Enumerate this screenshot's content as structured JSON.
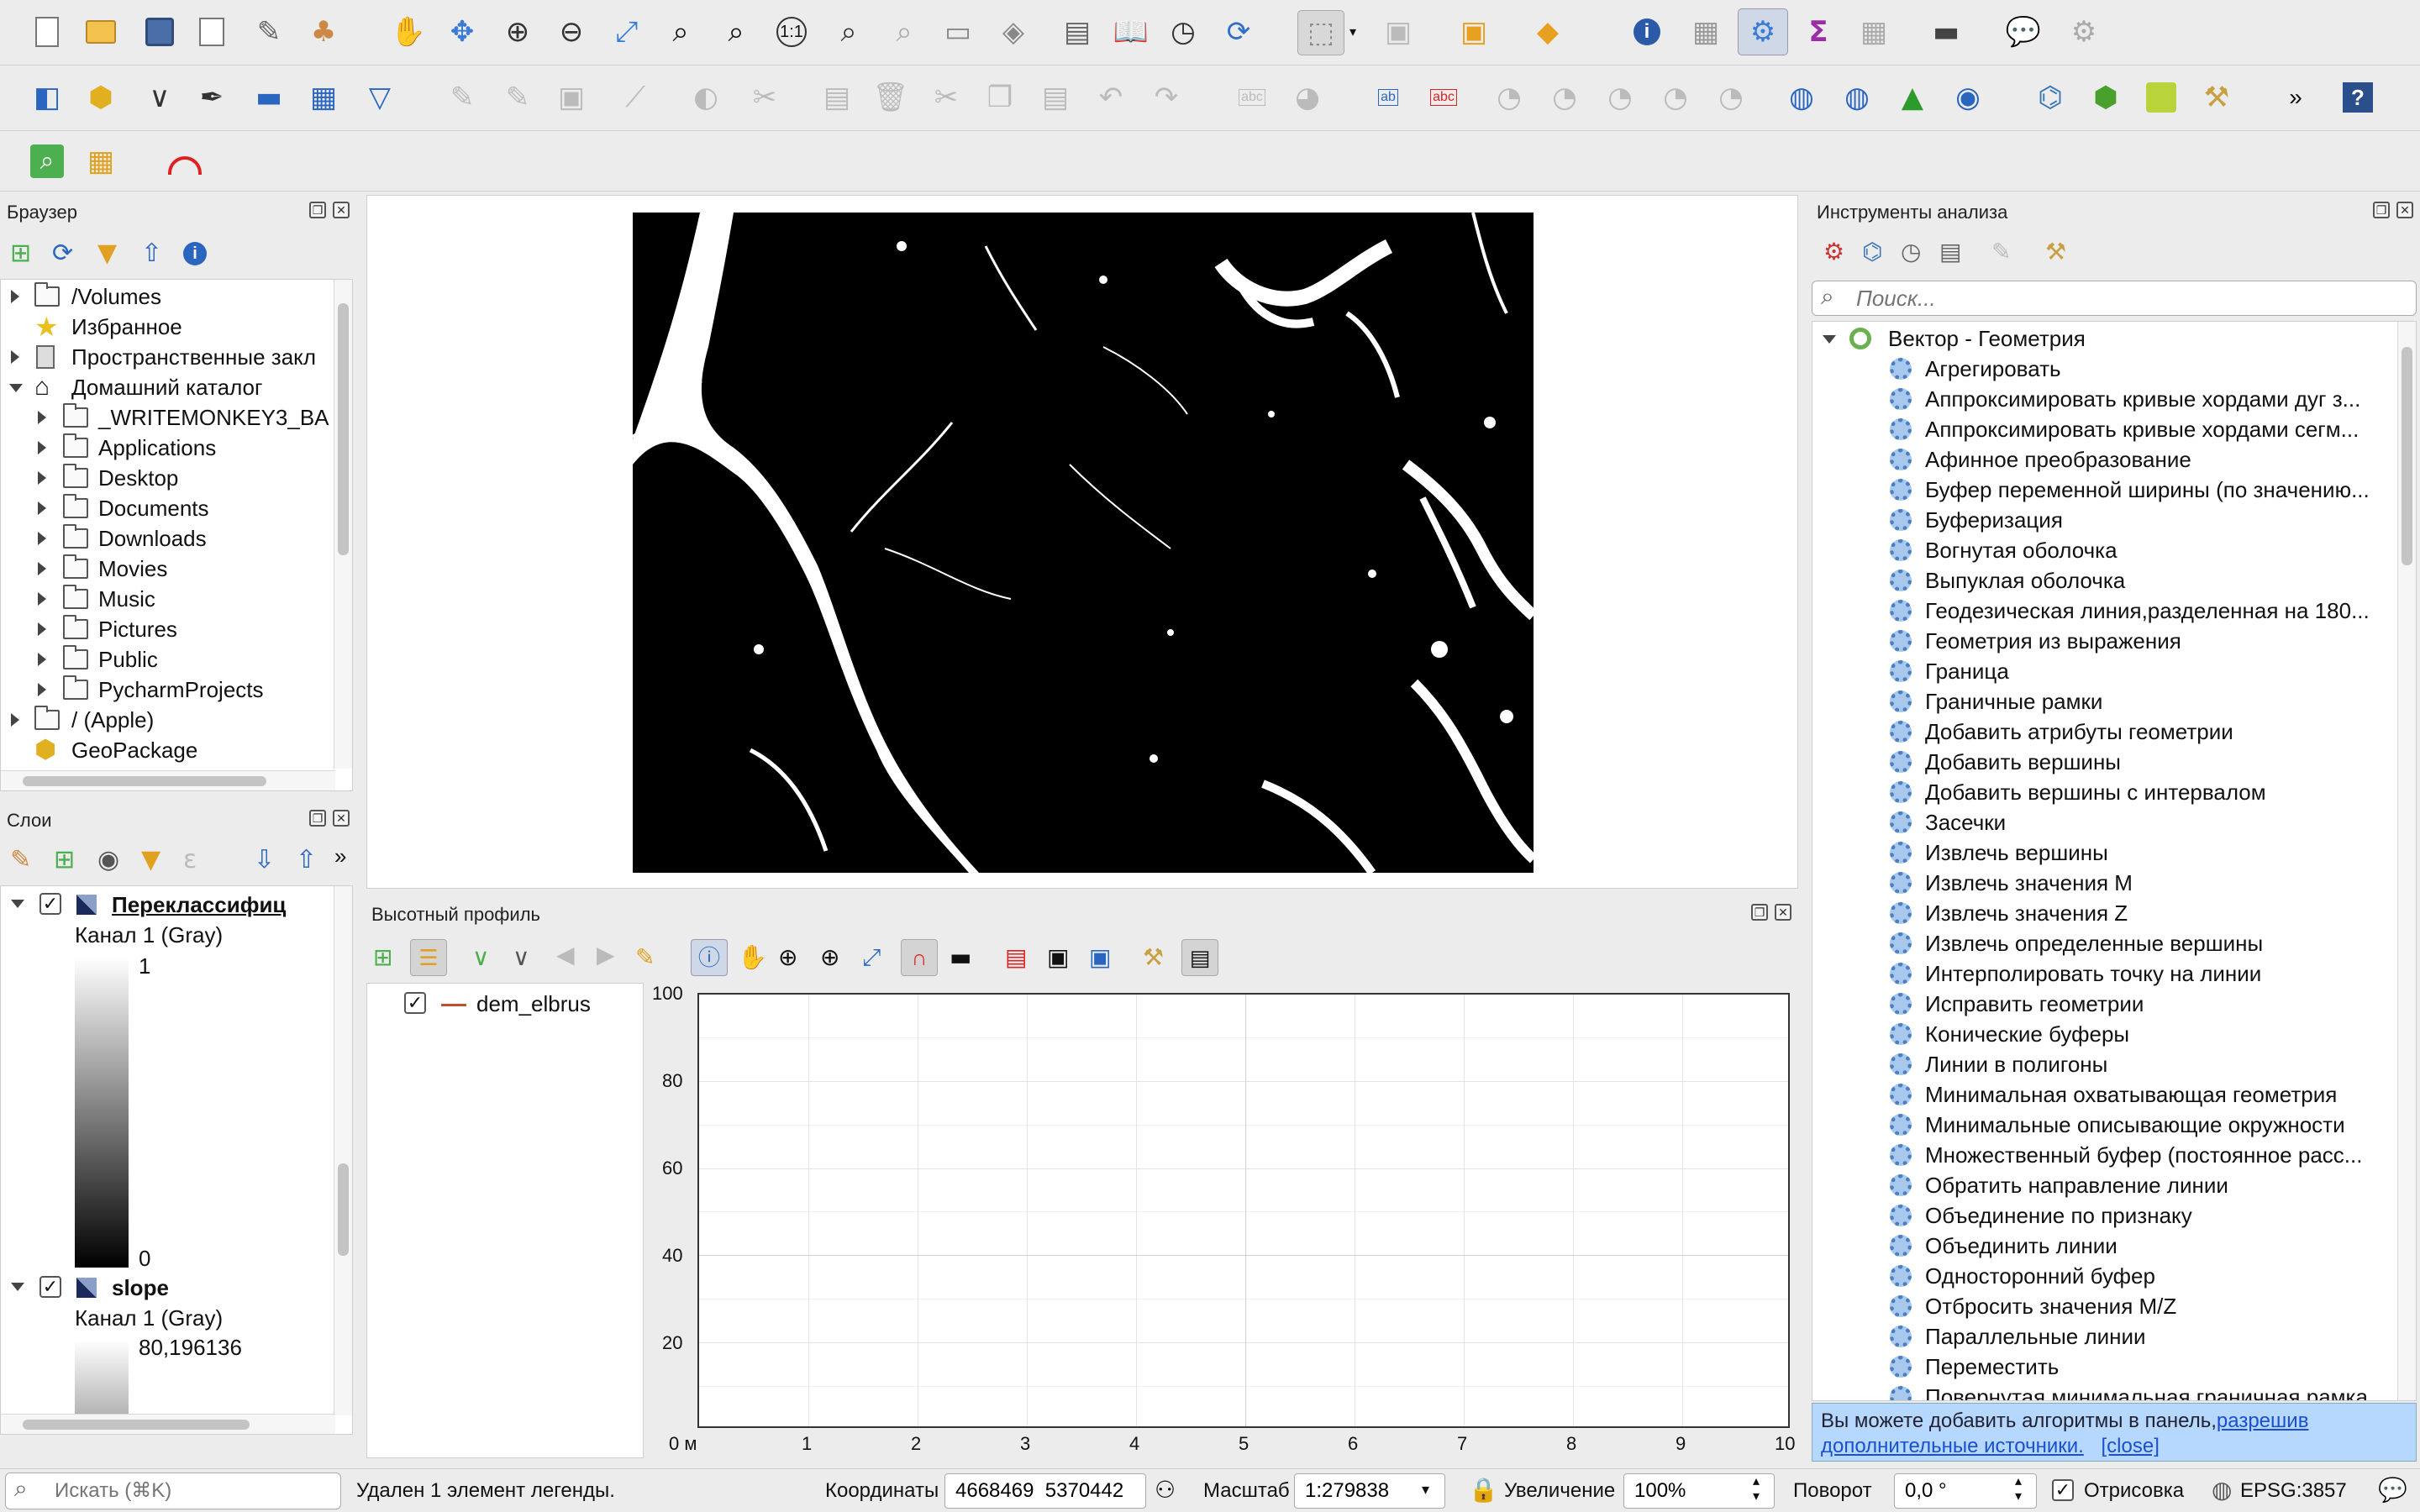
{
  "browser": {
    "title": "Браузер",
    "items": [
      {
        "label": "/Volumes"
      },
      {
        "label": "Избранное"
      },
      {
        "label": "Пространственные закл"
      },
      {
        "label": "Домашний каталог"
      },
      {
        "label": "_WRITEMONKEY3_BA"
      },
      {
        "label": "Applications"
      },
      {
        "label": "Desktop"
      },
      {
        "label": "Documents"
      },
      {
        "label": "Downloads"
      },
      {
        "label": "Movies"
      },
      {
        "label": "Music"
      },
      {
        "label": "Pictures"
      },
      {
        "label": "Public"
      },
      {
        "label": "PycharmProjects"
      },
      {
        "label": "/ (Apple)"
      },
      {
        "label": "GeoPackage"
      }
    ]
  },
  "layers": {
    "title": "Слои",
    "items": [
      {
        "name": "Переклассифиц",
        "band": "Канал 1 (Gray)",
        "max": "1",
        "min": "0"
      },
      {
        "name": "slope",
        "band": "Канал 1 (Gray)",
        "max": "80,196136"
      }
    ]
  },
  "profile": {
    "title": "Высотный профиль",
    "layer": "dem_elbrus",
    "y_ticks": [
      "100",
      "80",
      "60",
      "40",
      "20",
      "0 м"
    ],
    "x_ticks": [
      "1",
      "2",
      "3",
      "4",
      "5",
      "6",
      "7",
      "8",
      "9",
      "10"
    ]
  },
  "toolbox": {
    "title": "Инструменты анализа",
    "search_placeholder": "Поиск...",
    "group": "Вектор - Геометрия",
    "tools": [
      "Агрегировать",
      "Аппроксимировать кривые хордами дуг з...",
      "Аппроксимировать кривые хордами сегм...",
      "Афинное преобразование",
      "Буфер переменной ширины (по значению...",
      "Буферизация",
      "Вогнутая оболочка",
      "Выпуклая оболочка",
      "Геодезическая линия,разделенная на 180...",
      "Геометрия из выражения",
      "Граница",
      "Граничные рамки",
      "Добавить атрибуты геометрии",
      "Добавить вершины",
      "Добавить вершины с интервалом",
      "Засечки",
      "Извлечь вершины",
      "Извлечь значения M",
      "Извлечь значения Z",
      "Извлечь определенные вершины",
      "Интерполировать точку на линии",
      "Исправить геометрии",
      "Конические буферы",
      "Линии в полигоны",
      "Минимальная охватывающая геометрия",
      "Минимальные описывающие окружности",
      "Множественный буфер (постоянное расс...",
      "Обратить направление линии",
      "Объединение по признаку",
      "Объединить линии",
      "Односторонний буфер",
      "Отбросить значения M/Z",
      "Параллельные линии",
      "Переместить",
      "Повернутая минимальная граничная рамка"
    ],
    "notice_text": "Вы можете добавить алгоритмы в панель,",
    "notice_link": "разрешив дополнительные источники.",
    "notice_close": "[close]"
  },
  "status": {
    "search_placeholder": "Искать (⌘K)",
    "message": "Удален 1 элемент легенды.",
    "coord_label": "Координаты",
    "coord_value": "4668469  5370442",
    "scale_label": "Масштаб",
    "scale_value": "1:279838",
    "zoom_label": "Увеличение",
    "zoom_value": "100%",
    "rotation_label": "Поворот",
    "rotation_value": "0,0 °",
    "render_label": "Отрисовка",
    "crs": "EPSG:3857"
  }
}
